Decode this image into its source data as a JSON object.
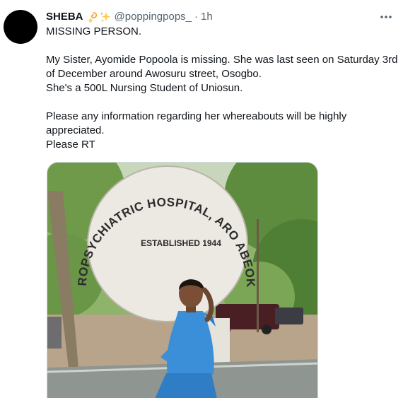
{
  "tweet": {
    "display_name": "SHEBA",
    "handle": "@poppingpops_",
    "separator": "·",
    "time": "1h",
    "more_icon": "more-horizontal-icon",
    "emoji_icons": [
      "dizzy-icon",
      "sparkles-icon"
    ],
    "lines": {
      "l1": "MISSING PERSON.",
      "l2": "My Sister, Ayomide Popoola is missing. She was last seen on Saturday 3rd of December around Awosuru street, Osogbo.",
      "l3": "She's a 500L Nursing Student of Uniosun.",
      "l4": "Please any information regarding her whereabouts will be highly appreciated.",
      "l5": "Please RT"
    }
  },
  "photo": {
    "sign_arc_text": "NEUROPSYCHIATRIC HOSPITAL, ARO ABEOKUTA",
    "sign_established": "ESTABLISHED 1944"
  },
  "colors": {
    "text": "#0f1419",
    "secondary": "#536471",
    "border": "#cfd9de",
    "scrubs": "#3a8fd8"
  }
}
